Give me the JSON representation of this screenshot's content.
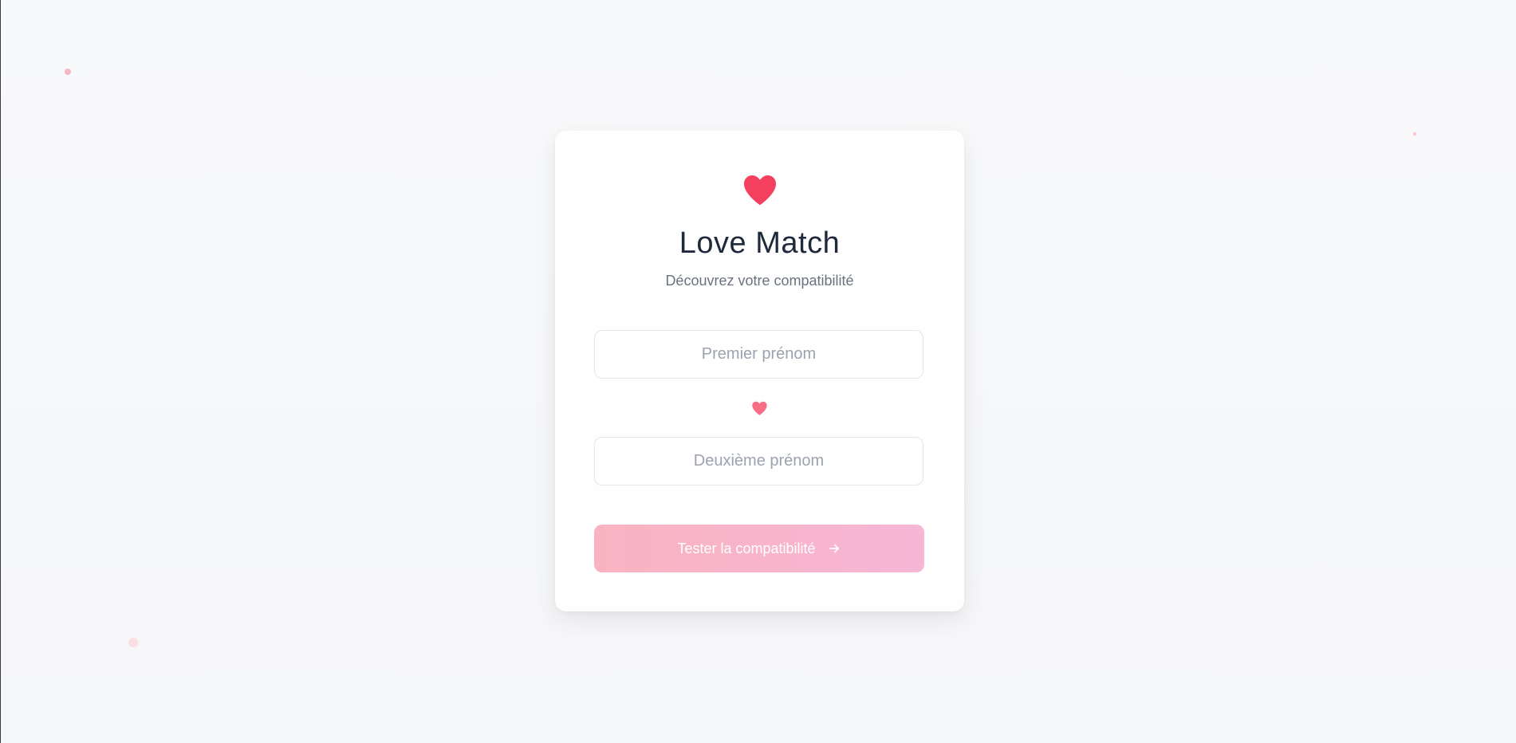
{
  "app": {
    "title": "Love Match",
    "subtitle": "Découvrez votre compatibilité"
  },
  "form": {
    "first_name": {
      "value": "",
      "placeholder": "Premier prénom"
    },
    "second_name": {
      "value": "",
      "placeholder": "Deuxième prénom"
    },
    "submit_label": "Tester la compatibilité"
  },
  "icons": {
    "main": "heart-icon",
    "separator": "heart-icon",
    "submit": "arrow-right-icon"
  },
  "colors": {
    "heart_primary": "#f43f5e",
    "heart_secondary": "#f76d83",
    "button_gradient_start": "#f9b3c0",
    "button_gradient_end": "#f6b6d6",
    "title_text": "#1e293b",
    "subtitle_text": "#6b7280"
  }
}
